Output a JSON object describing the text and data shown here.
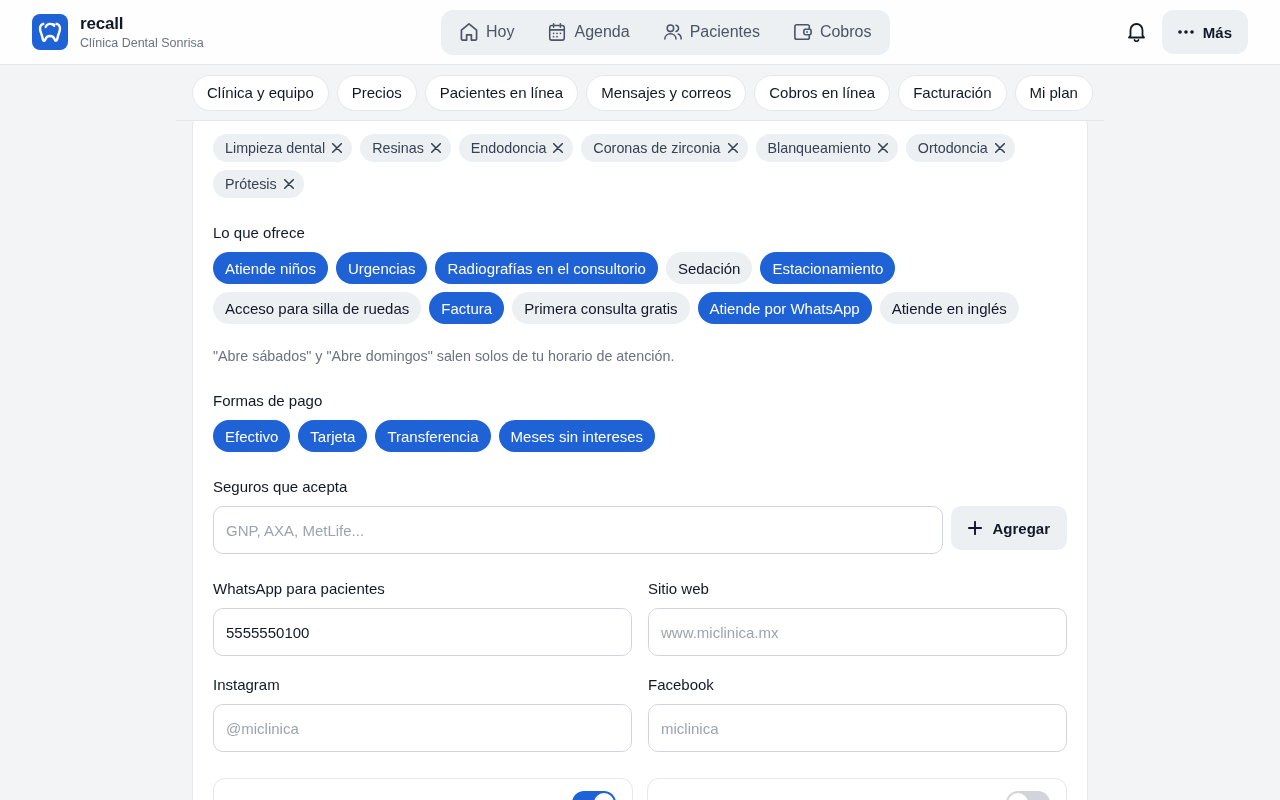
{
  "header": {
    "app_name": "recall",
    "clinic_name": "Clínica Dental Sonrisa",
    "nav": [
      "Hoy",
      "Agenda",
      "Pacientes",
      "Cobros"
    ],
    "more_button": "Más"
  },
  "section_tabs": [
    "Clínica y equipo",
    "Precios",
    "Pacientes en línea",
    "Mensajes y correos",
    "Cobros en línea",
    "Facturación",
    "Mi plan"
  ],
  "form": {
    "sections": [
      {
        "kind": "tags",
        "tags": [
          "Limpieza dental",
          "Resinas",
          "Endodoncia",
          "Coronas de zirconia",
          "Blanqueamiento",
          "Ortodoncia",
          "Prótesis"
        ]
      },
      {
        "kind": "options",
        "label": "Lo que ofrece",
        "chips": [
          {
            "label": "Atiende niños",
            "selected": true
          },
          {
            "label": "Urgencias",
            "selected": true
          },
          {
            "label": "Radiografías en el consultorio",
            "selected": true
          },
          {
            "label": "Sedación",
            "selected": false
          },
          {
            "label": "Estacionamiento",
            "selected": true
          },
          {
            "label": "Acceso para silla de ruedas",
            "selected": false
          },
          {
            "label": "Factura",
            "selected": true
          },
          {
            "label": "Primera consulta gratis",
            "selected": false
          },
          {
            "label": "Atiende por WhatsApp",
            "selected": true
          },
          {
            "label": "Atiende en inglés",
            "selected": false
          }
        ],
        "note": "\"Abre sábados\" y \"Abre domingos\" salen solos de tu horario de atención."
      },
      {
        "kind": "options",
        "label": "Formas de pago",
        "chips": [
          {
            "label": "Efectivo",
            "selected": true
          },
          {
            "label": "Tarjeta",
            "selected": true
          },
          {
            "label": "Transferencia",
            "selected": true
          },
          {
            "label": "Meses sin intereses",
            "selected": true
          }
        ]
      },
      {
        "kind": "add_field",
        "label": "Seguros que acepta",
        "placeholder": "GNP, AXA, MetLife...",
        "button": "Agregar"
      },
      {
        "kind": "fields",
        "fields": [
          {
            "label": "WhatsApp para pacientes",
            "value": "5555550100"
          },
          {
            "label": "Sitio web",
            "placeholder": "www.miclinica.mx"
          },
          {
            "label": "Instagram",
            "placeholder": "@miclinica"
          },
          {
            "label": "Facebook",
            "placeholder": "miclinica"
          }
        ]
      },
      {
        "kind": "toggles",
        "toggles": [
          {
            "on": true
          },
          {
            "on": false
          }
        ]
      }
    ]
  }
}
